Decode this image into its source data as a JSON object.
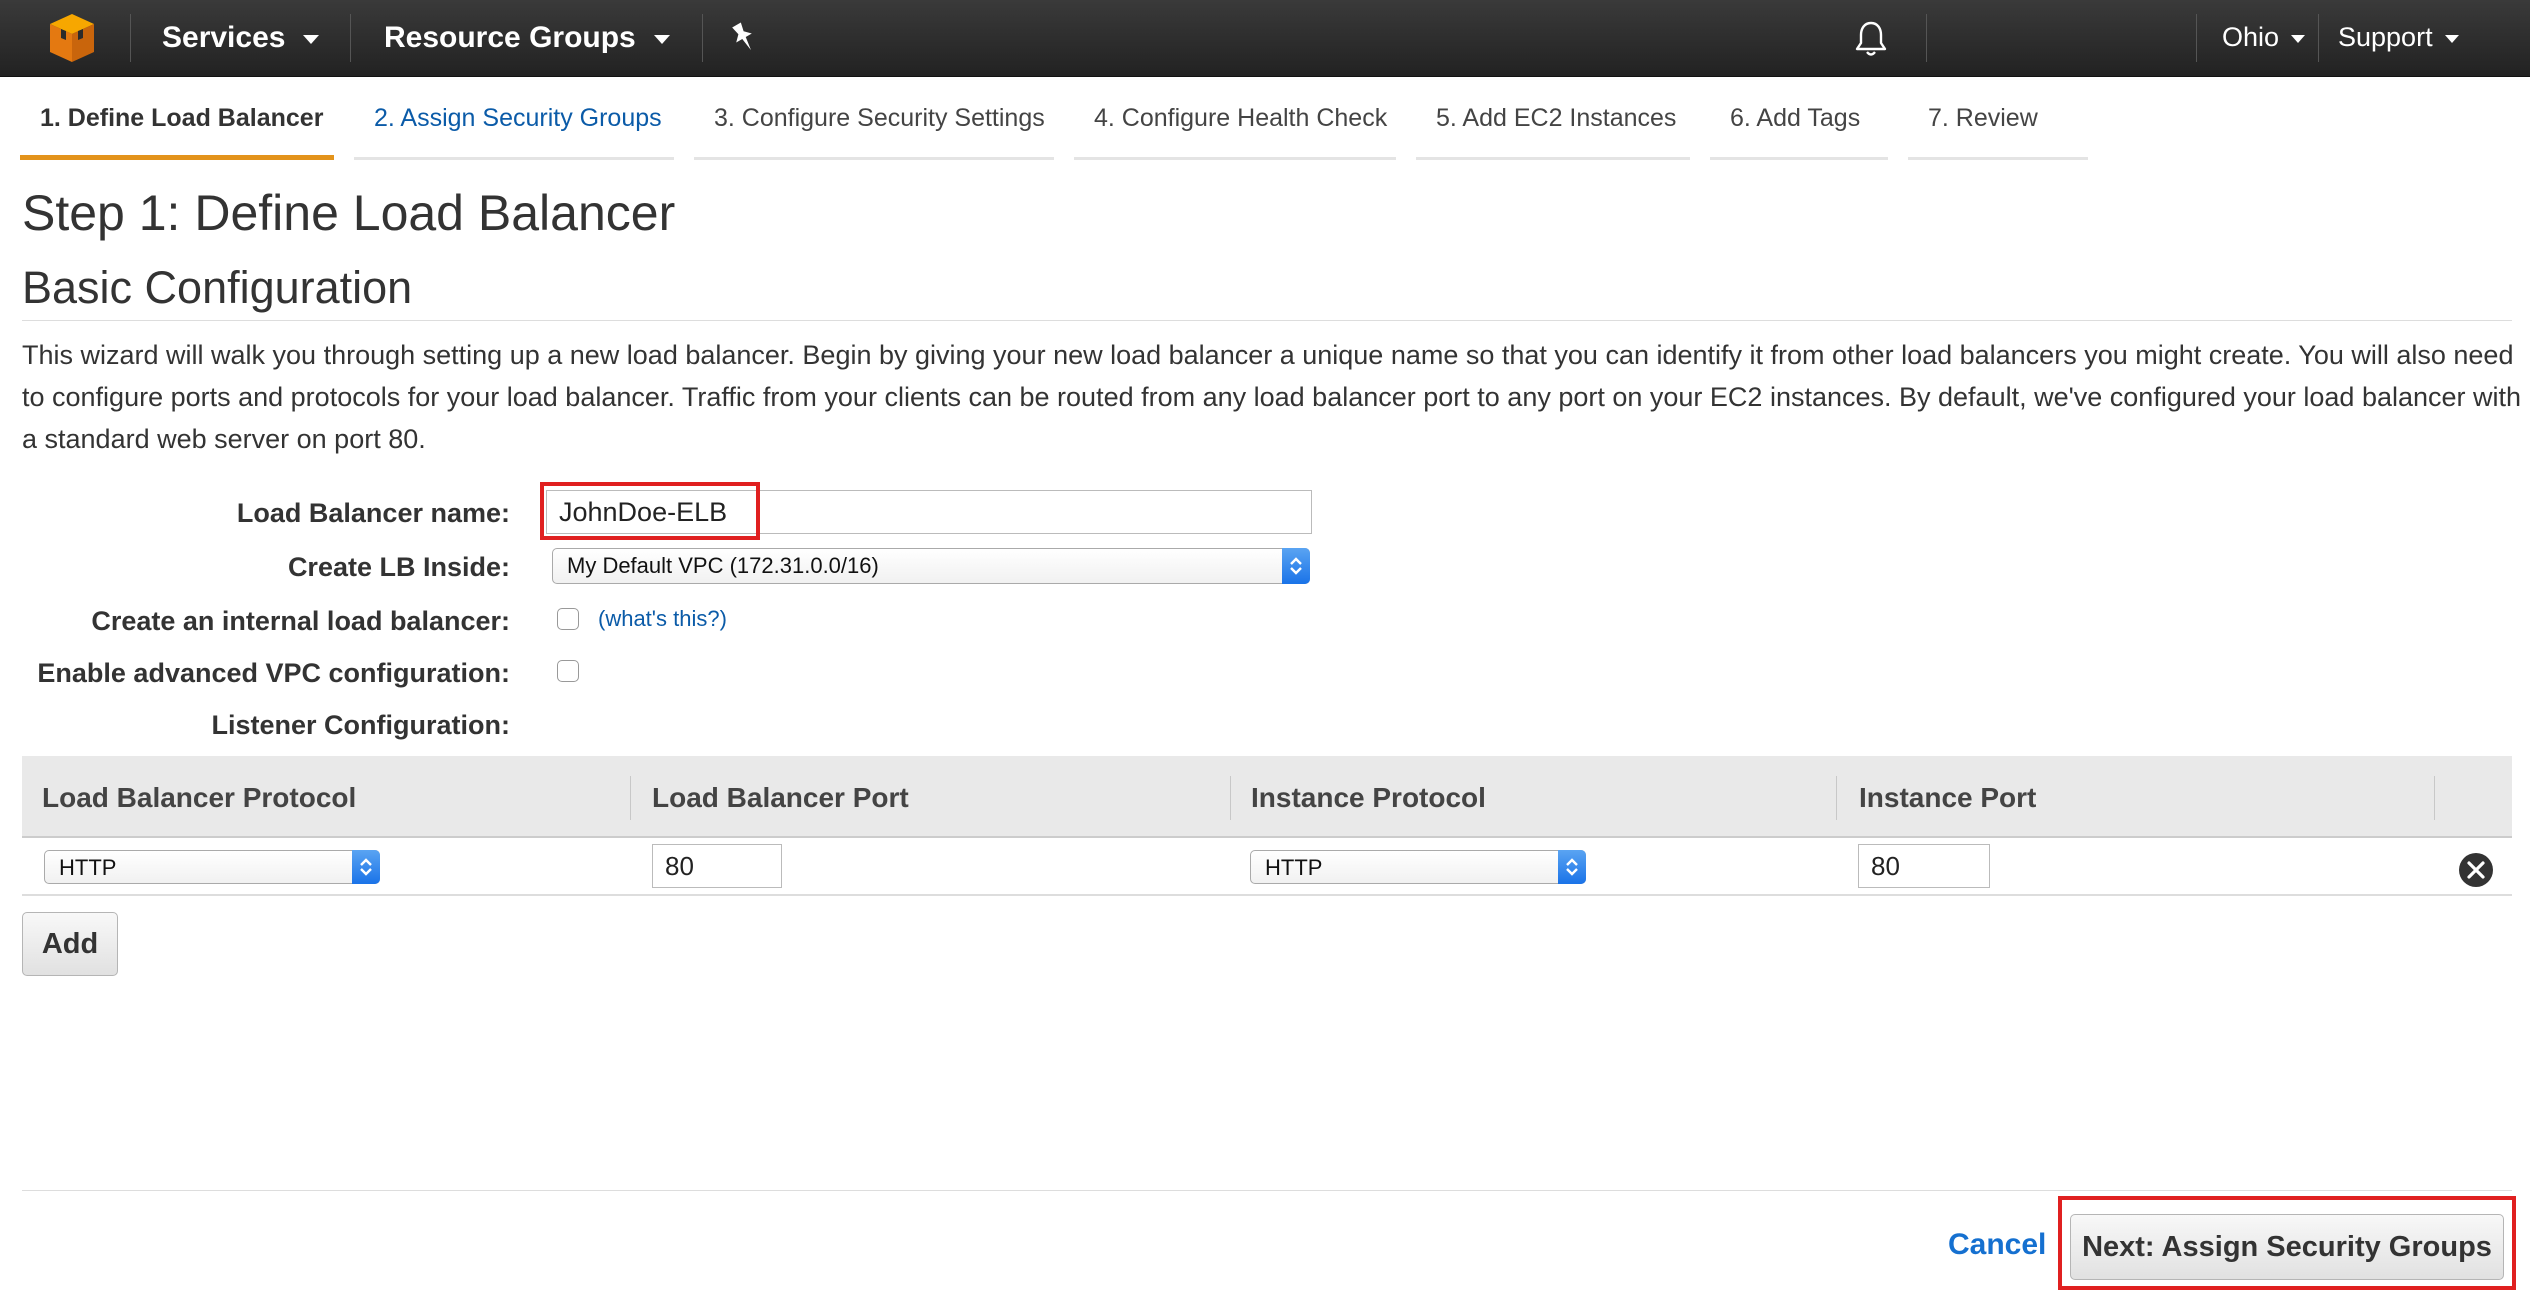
{
  "nav": {
    "services": "Services",
    "resource_groups": "Resource Groups",
    "region": "Ohio",
    "support": "Support"
  },
  "tabs": [
    {
      "label": "1. Define Load Balancer",
      "state": "active"
    },
    {
      "label": "2. Assign Security Groups",
      "state": "next"
    },
    {
      "label": "3. Configure Security Settings",
      "state": "inactive"
    },
    {
      "label": "4. Configure Health Check",
      "state": "inactive"
    },
    {
      "label": "5. Add EC2 Instances",
      "state": "inactive"
    },
    {
      "label": "6. Add Tags",
      "state": "inactive"
    },
    {
      "label": "7. Review",
      "state": "inactive"
    }
  ],
  "page": {
    "step_title": "Step 1: Define Load Balancer",
    "section_title": "Basic Configuration",
    "intro": "This wizard will walk you through setting up a new load balancer. Begin by giving your new load balancer a unique name so that you can identify it from other load balancers you might create. You will also need to configure ports and protocols for your load balancer. Traffic from your clients can be routed from any load balancer port to any port on your EC2 instances. By default, we've configured your load balancer with a standard web server on port 80."
  },
  "form": {
    "name_label": "Load Balancer name:",
    "name_value": "JohnDoe-ELB",
    "vpc_label": "Create LB Inside:",
    "vpc_value": "My Default VPC (172.31.0.0/16)",
    "internal_label": "Create an internal load balancer:",
    "internal_checked": false,
    "help_link": "(what's this?)",
    "advanced_vpc_label": "Enable advanced VPC configuration:",
    "advanced_vpc_checked": false,
    "listener_label": "Listener Configuration:"
  },
  "listeners": {
    "headers": [
      "Load Balancer Protocol",
      "Load Balancer Port",
      "Instance Protocol",
      "Instance Port"
    ],
    "rows": [
      {
        "lb_protocol": "HTTP",
        "lb_port": "80",
        "instance_protocol": "HTTP",
        "instance_port": "80"
      }
    ],
    "add_label": "Add"
  },
  "footer": {
    "cancel_label": "Cancel",
    "next_label": "Next: Assign Security Groups"
  },
  "colors": {
    "accent_tab": "#e3931b",
    "link": "#0b5ba8",
    "highlight": "#e02020",
    "select_arrows": "#1a73e8"
  }
}
